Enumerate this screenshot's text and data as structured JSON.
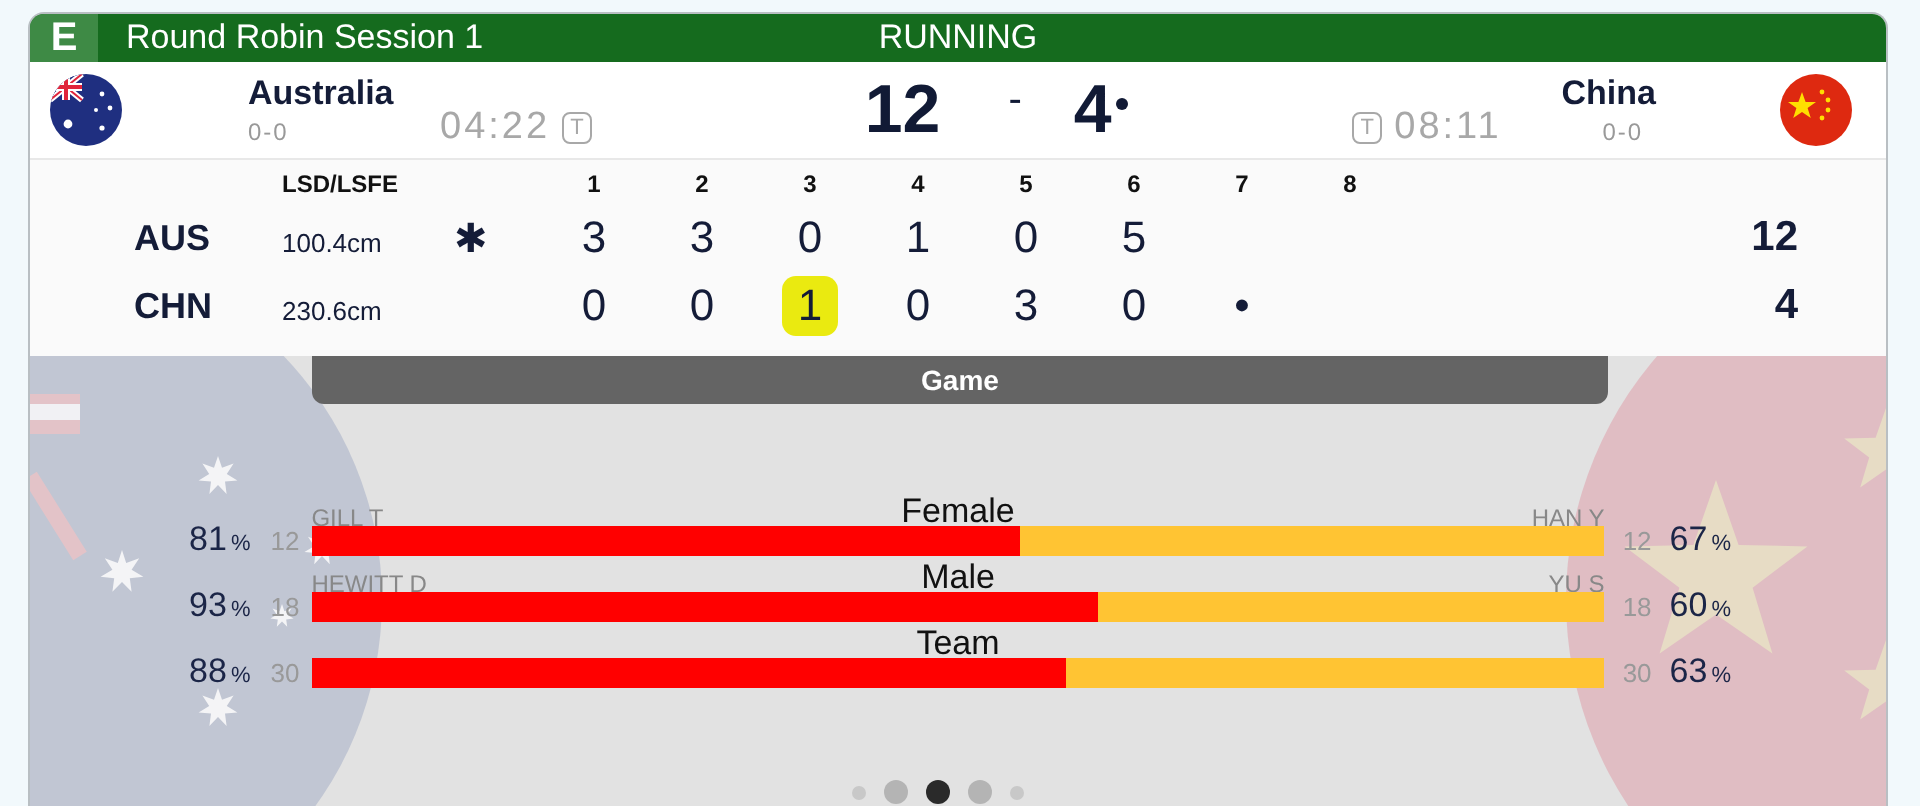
{
  "header": {
    "badge": "E",
    "title": "Round Robin Session 1",
    "status": "RUNNING"
  },
  "teams": [
    {
      "kind": "home",
      "name": "Australia",
      "record": "0-0",
      "clock": "04:22",
      "timeout_label": "T",
      "score": "12",
      "hammer": false
    },
    {
      "kind": "away",
      "name": "China",
      "record": "0-0",
      "clock": "08:11",
      "timeout_label": "T",
      "score": "4",
      "hammer": true
    }
  ],
  "score_separator": "-",
  "ends_table": {
    "columns": [
      "LSD/LSFE",
      "1",
      "2",
      "3",
      "4",
      "5",
      "6",
      "7",
      "8"
    ],
    "rows": [
      {
        "code": "AUS",
        "lsd": "100.4cm",
        "marker": "✱",
        "ends": [
          {
            "value": "3",
            "highlighted": false
          },
          {
            "value": "3",
            "highlighted": false
          },
          {
            "value": "0",
            "highlighted": false
          },
          {
            "value": "1",
            "highlighted": false
          },
          {
            "value": "0",
            "highlighted": false
          },
          {
            "value": "5",
            "highlighted": false
          }
        ],
        "total": "12"
      },
      {
        "code": "CHN",
        "lsd": "230.6cm",
        "ends": [
          {
            "value": "0",
            "highlighted": false
          },
          {
            "value": "0",
            "highlighted": false
          },
          {
            "value": "1",
            "highlighted": true
          },
          {
            "value": "0",
            "highlighted": false
          },
          {
            "value": "3",
            "highlighted": false
          },
          {
            "value": "0",
            "highlighted": false
          },
          {
            "value": "•",
            "highlighted": false
          }
        ],
        "total": "4"
      }
    ]
  },
  "section_title": "Game",
  "stats": [
    {
      "title": "Female",
      "home_player": "GILL T",
      "away_player": "HAN Y",
      "home_pct": "81",
      "home_count": "12",
      "away_count": "12",
      "away_pct": "67",
      "unit": "%",
      "level": 0.548
    },
    {
      "title": "Male",
      "home_player": "HEWITT D",
      "away_player": "YU S",
      "home_pct": "93",
      "home_count": "18",
      "away_count": "18",
      "away_pct": "60",
      "unit": "%",
      "level": 0.608
    },
    {
      "title": "Team",
      "home_pct": "88",
      "home_count": "30",
      "away_count": "30",
      "away_pct": "63",
      "unit": "%",
      "level": 0.583
    }
  ],
  "pages": [
    {
      "selected": false
    },
    {
      "selected": false
    },
    {
      "selected": true
    },
    {
      "selected": false
    },
    {
      "selected": false
    }
  ]
}
